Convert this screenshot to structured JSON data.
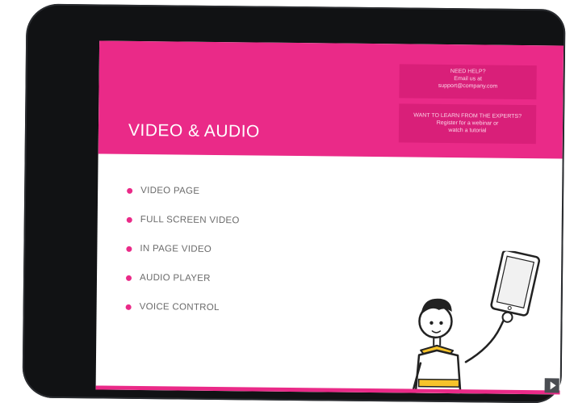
{
  "screen": {
    "title": "VIDEO & AUDIO",
    "help": {
      "line1": "NEED HELP?",
      "line2": "Email us at",
      "line3": "support@company.com"
    },
    "experts": {
      "line1": "WANT TO LEARN FROM THE EXPERTS?",
      "line2": "Register for a webinar or",
      "line3": "watch a tutorial"
    },
    "menu": [
      {
        "label": "VIDEO PAGE"
      },
      {
        "label": "FULL SCREEN VIDEO"
      },
      {
        "label": "IN PAGE VIDEO"
      },
      {
        "label": "AUDIO PLAYER"
      },
      {
        "label": "VOICE CONTROL"
      }
    ],
    "play_icon": "play-icon"
  },
  "colors": {
    "accent": "#ea2a88",
    "help_box": "#d91f79",
    "bezel": "#111214",
    "text": "#6b6b6b"
  }
}
